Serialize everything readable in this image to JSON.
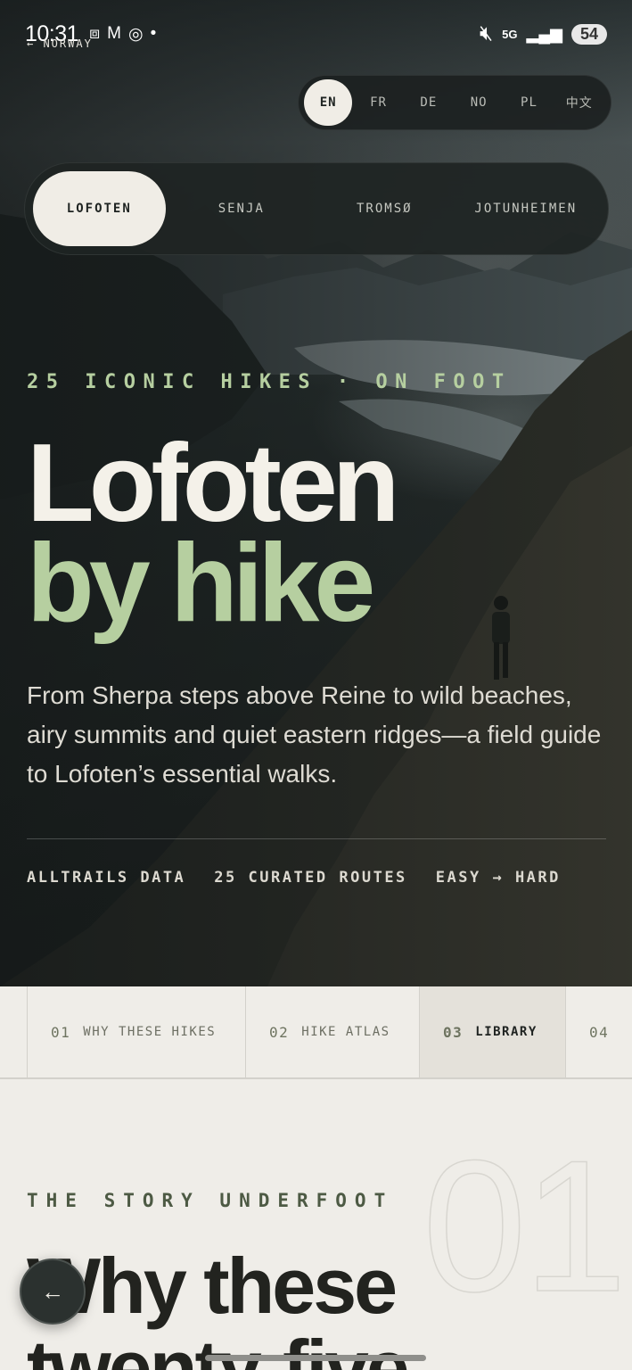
{
  "status_bar": {
    "time": "10:31",
    "battery": "54",
    "network": "5G"
  },
  "brand": {
    "label": "← NORWAY"
  },
  "languages": {
    "options": [
      "EN",
      "FR",
      "DE",
      "NO",
      "PL",
      "中文"
    ],
    "selected": "EN"
  },
  "regions": {
    "tabs": [
      "LOFOTEN",
      "SENJA",
      "TROMSØ",
      "JOTUNHEIMEN"
    ],
    "selected": "LOFOTEN"
  },
  "hero": {
    "kicker": "25 ICONIC HIKES · ON FOOT",
    "title_line1": "Lofoten",
    "title_line2": "by hike",
    "lede": "From Sherpa steps above Reine to wild beaches, airy summits and quiet eastern ridges—a field guide to Lofoten’s essential walks.",
    "meta": [
      "ALLTRAILS DATA",
      "25 CURATED ROUTES",
      "EASY → HARD"
    ]
  },
  "section_nav": {
    "items": [
      {
        "num": "01",
        "label": "WHY THESE HIKES"
      },
      {
        "num": "02",
        "label": "HIKE ATLAS"
      },
      {
        "num": "03",
        "label": "LIBRARY"
      },
      {
        "num": "04",
        "label": ""
      }
    ],
    "active": "03"
  },
  "story": {
    "big_number": "01",
    "eyebrow": "THE STORY UNDERFOOT",
    "title_line1": "Why these",
    "title_line2": "twenty-five"
  },
  "back_button": {
    "label": "←"
  },
  "colors": {
    "accent_green": "#b6cfa0",
    "cream": "#f0ede6",
    "dark": "#1f2422",
    "page_bg": "#efede8"
  }
}
